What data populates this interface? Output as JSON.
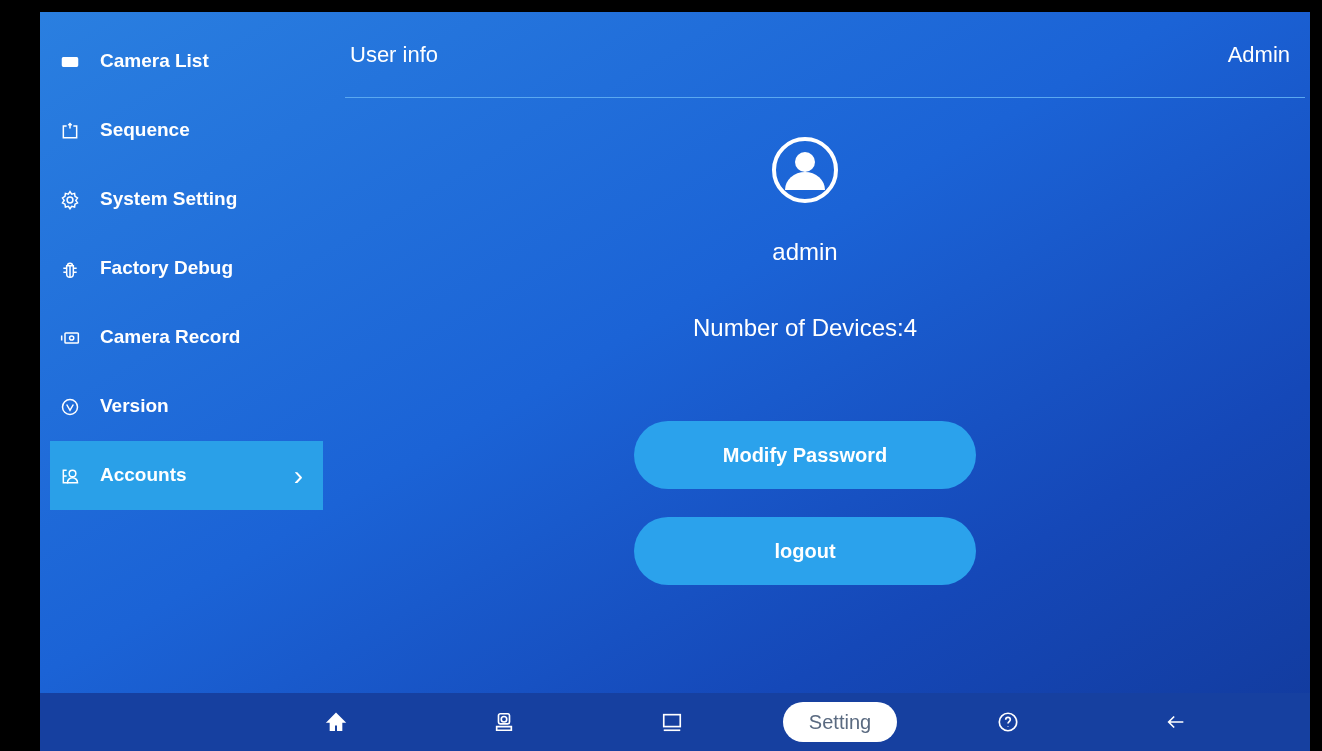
{
  "sidebar": {
    "items": [
      {
        "label": "Camera List",
        "selected": false
      },
      {
        "label": "Sequence",
        "selected": false
      },
      {
        "label": "System Setting",
        "selected": false
      },
      {
        "label": "Factory Debug",
        "selected": false
      },
      {
        "label": "Camera Record",
        "selected": false
      },
      {
        "label": "Version",
        "selected": false
      },
      {
        "label": "Accounts",
        "selected": true,
        "chevron": "›"
      }
    ]
  },
  "header": {
    "title": "User info",
    "user": "Admin"
  },
  "profile": {
    "name": "admin",
    "devices": "Number of Devices:4"
  },
  "buttons": [
    "Modify Password",
    "logout"
  ],
  "bottom_nav": [
    {
      "selected": false
    },
    {
      "selected": false
    },
    {
      "selected": false
    },
    {
      "label": "Setting",
      "selected": true
    },
    {
      "selected": false
    },
    {
      "selected": false
    }
  ]
}
